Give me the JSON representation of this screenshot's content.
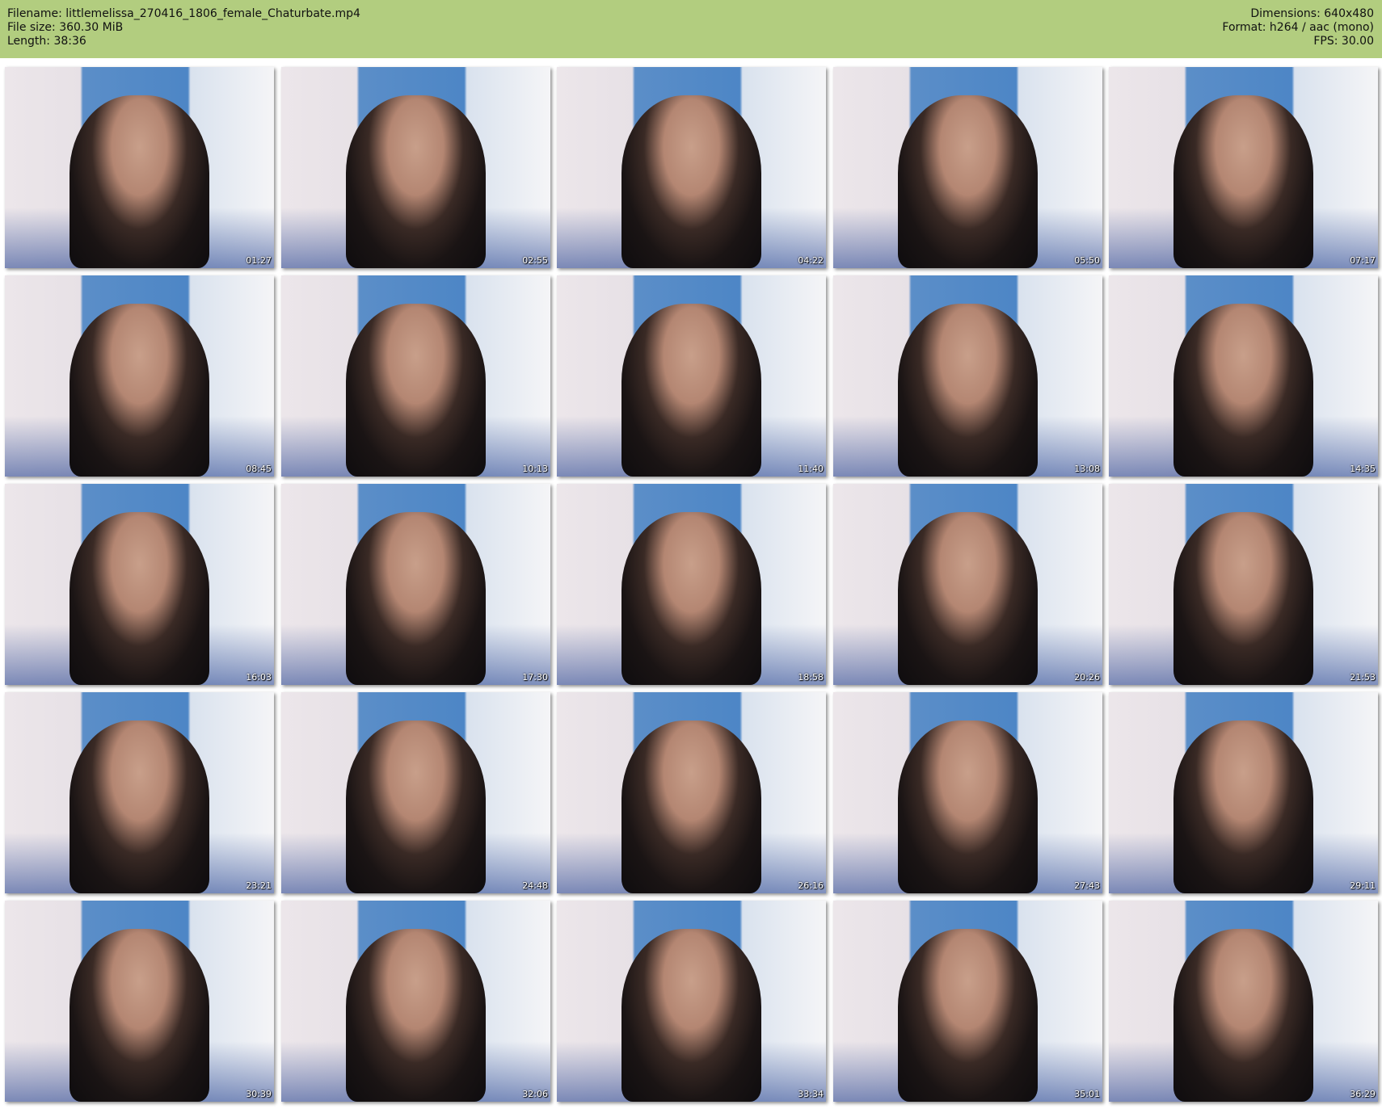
{
  "header": {
    "filename_label": "Filename: littlemelissa_270416_1806_female_Chaturbate.mp4",
    "filesize_label": "File size: 360.30 MiB",
    "length_label": "Length: 38:36",
    "dimensions_label": "Dimensions: 640x480",
    "format_label": "Format: h264 / aac (mono)",
    "fps_label": "FPS: 30.00"
  },
  "thumbnails": [
    "01:27",
    "02:55",
    "04:22",
    "05:50",
    "07:17",
    "08:45",
    "10:13",
    "11:40",
    "13:08",
    "14:35",
    "16:03",
    "17:30",
    "18:58",
    "20:26",
    "21:53",
    "23:21",
    "24:48",
    "26:16",
    "27:43",
    "29:11",
    "30:39",
    "32:06",
    "33:34",
    "35:01",
    "36:29"
  ],
  "colors": {
    "header_bg": "#b2cd7f"
  }
}
